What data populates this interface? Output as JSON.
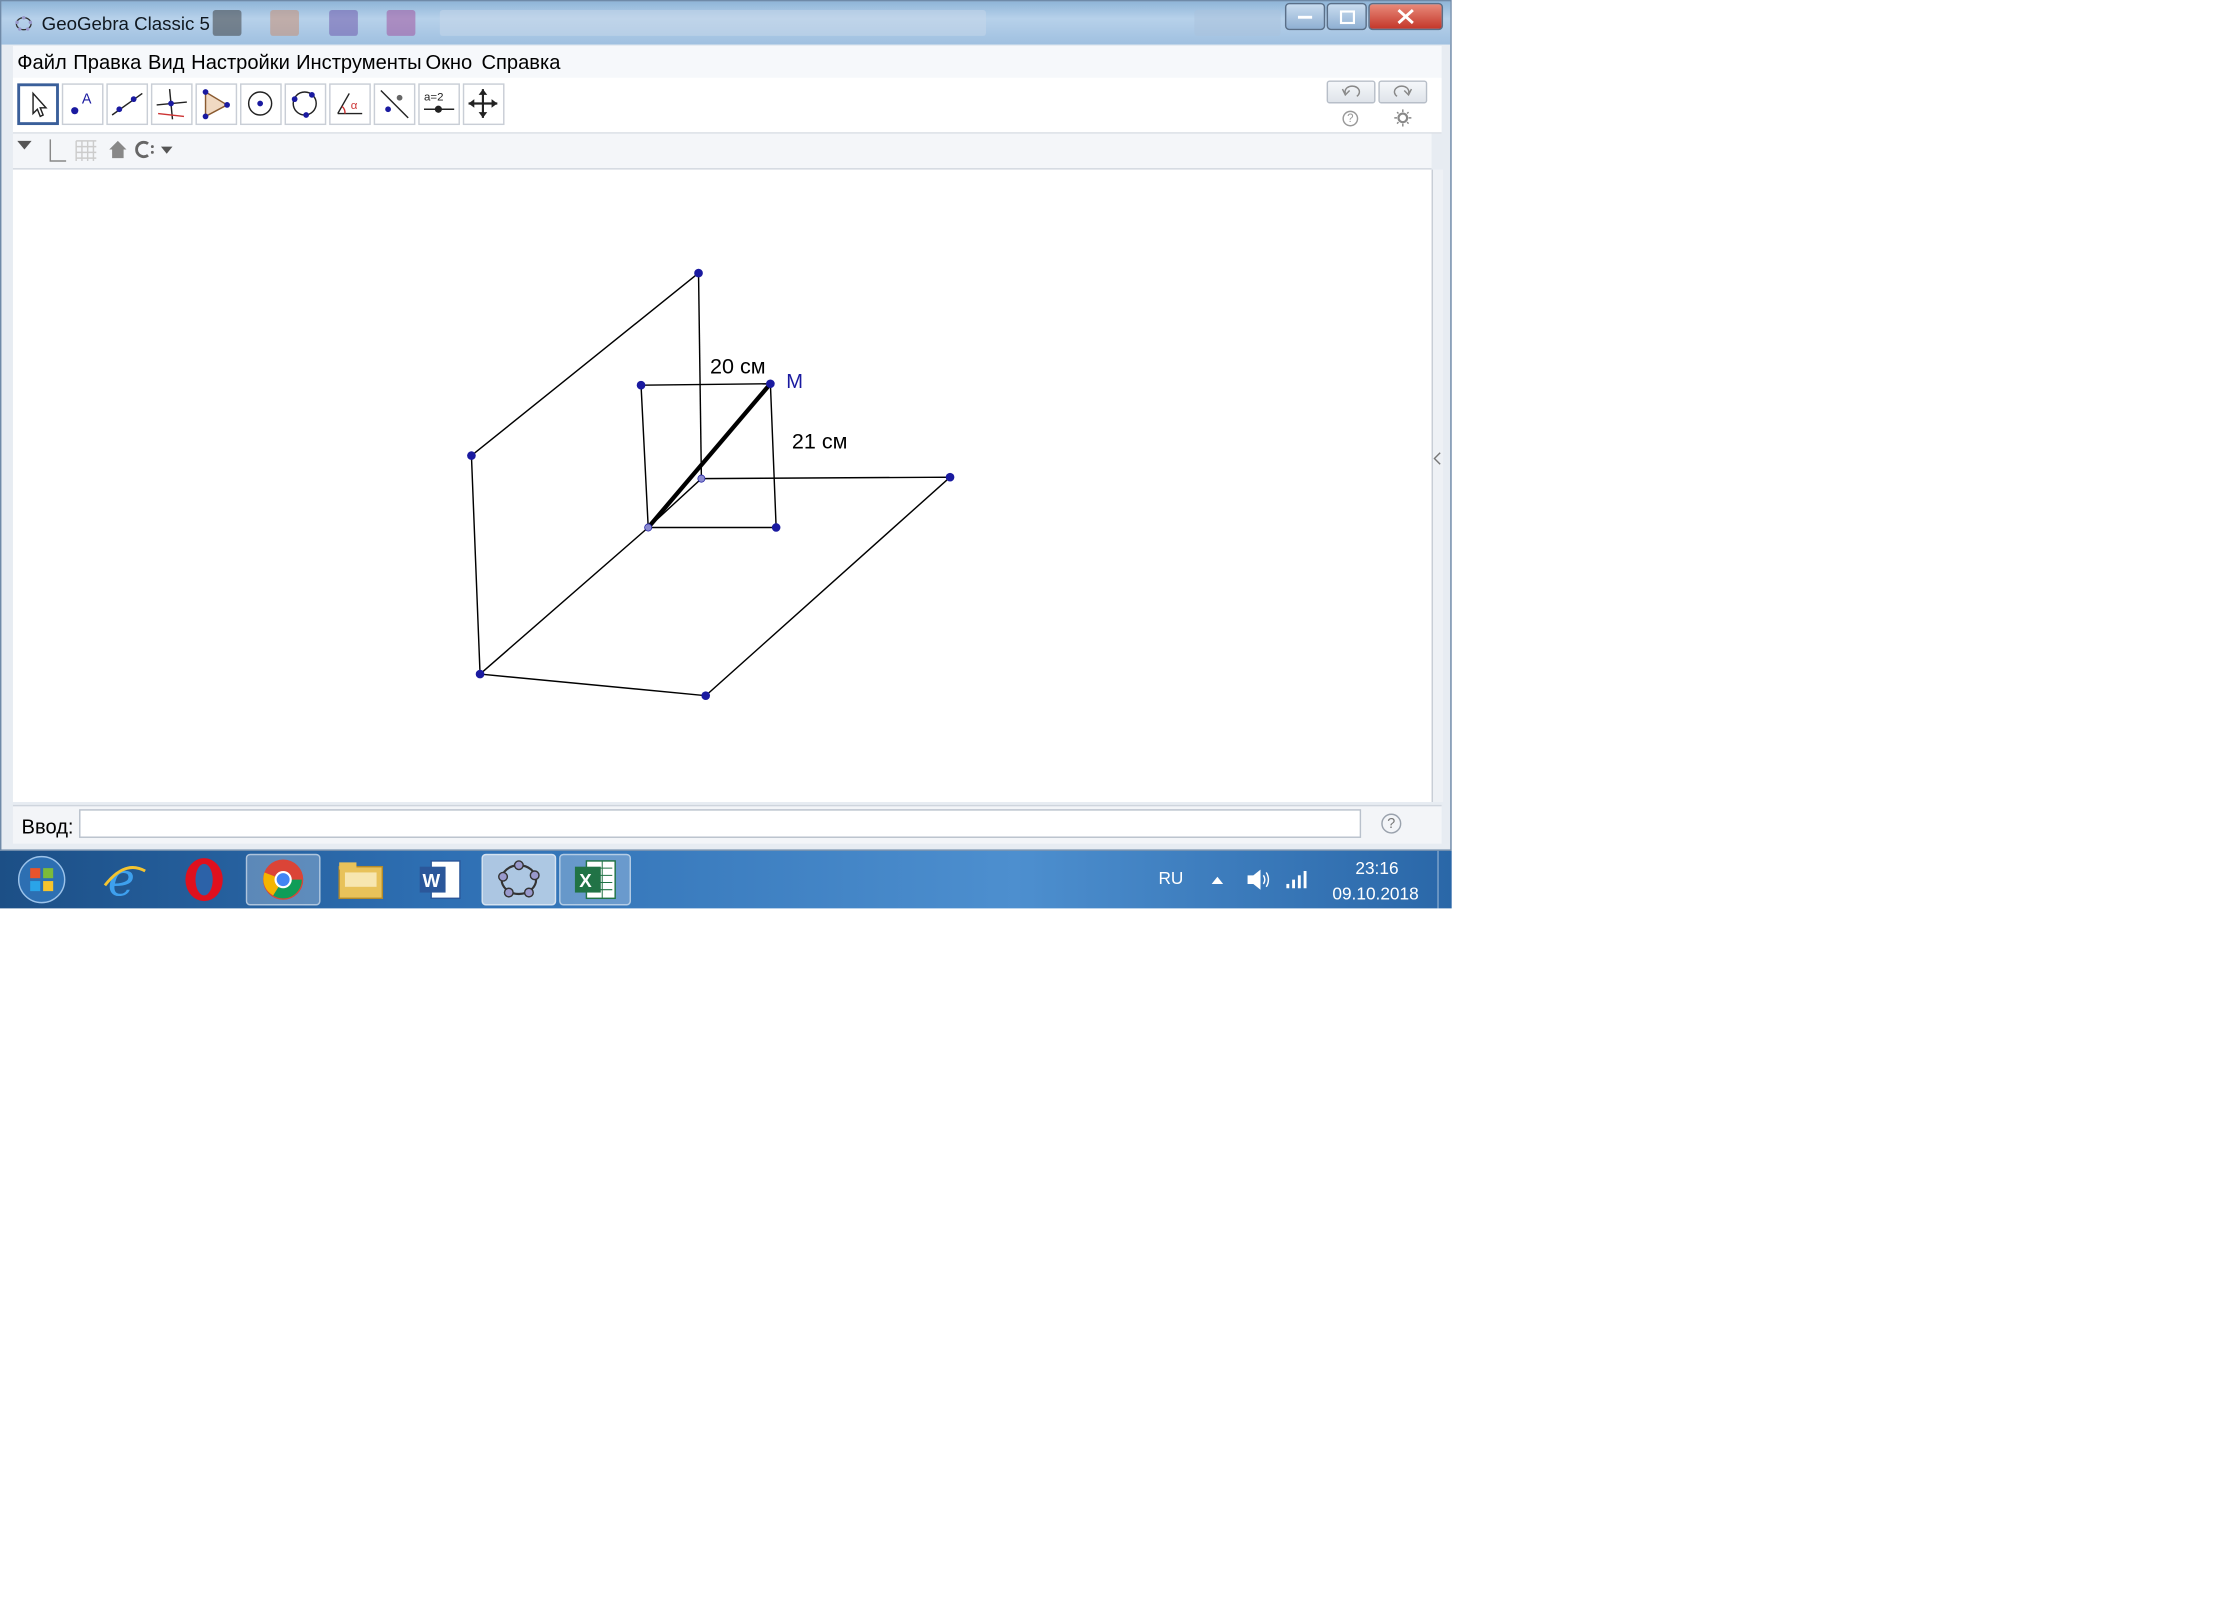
{
  "window": {
    "title": "GeoGebra Classic 5"
  },
  "menu": [
    "Файл",
    "Правка",
    "Вид",
    "Настройки",
    "Инструменты",
    "Окно",
    "Справка"
  ],
  "tools": [
    "move-tool-icon",
    "point-tool-icon",
    "line-tool-icon",
    "perpendicular-tool-icon",
    "polygon-tool-icon",
    "circle-tool-icon",
    "circle-three-points-tool-icon",
    "angle-tool-icon",
    "reflect-tool-icon",
    "slider-tool-icon",
    "move-view-tool-icon"
  ],
  "tool_slider_label": "a=2",
  "canvas": {
    "label_top": "20 см",
    "label_side": "21 см",
    "point_label": "M",
    "colors": {
      "point": "#1a1aa0",
      "line": "#000000",
      "label_point": "#1a1aa0"
    }
  },
  "input": {
    "label": "Ввод:",
    "value": "",
    "help": "?"
  },
  "taskbar": {
    "apps": [
      "start-orb-icon",
      "internet-explorer-icon",
      "opera-icon",
      "chrome-icon",
      "file-explorer-icon",
      "word-icon",
      "geogebra-icon",
      "excel-icon"
    ],
    "language": "RU",
    "time": "23:16",
    "date": "09.10.2018"
  }
}
